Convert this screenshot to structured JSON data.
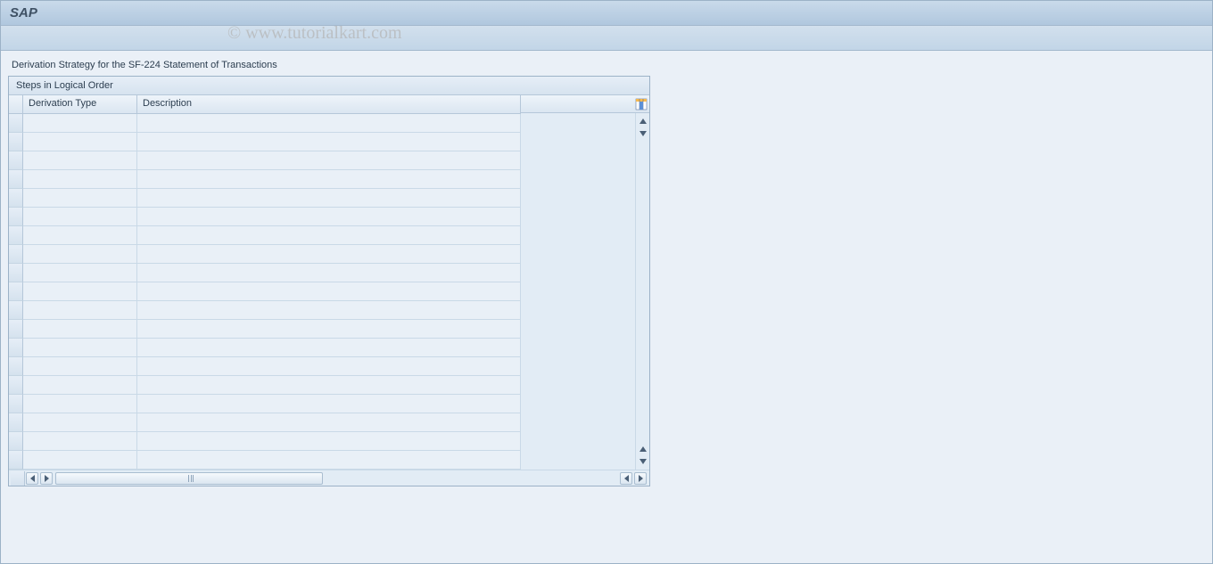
{
  "app": {
    "title": "SAP"
  },
  "page": {
    "subtitle": "Derivation Strategy for the SF-224 Statement of Transactions"
  },
  "table": {
    "title": "Steps in Logical Order",
    "columns": {
      "derivation_type": "Derivation Type",
      "description": "Description"
    },
    "rows": [
      {
        "derivation_type": "",
        "description": ""
      },
      {
        "derivation_type": "",
        "description": ""
      },
      {
        "derivation_type": "",
        "description": ""
      },
      {
        "derivation_type": "",
        "description": ""
      },
      {
        "derivation_type": "",
        "description": ""
      },
      {
        "derivation_type": "",
        "description": ""
      },
      {
        "derivation_type": "",
        "description": ""
      },
      {
        "derivation_type": "",
        "description": ""
      },
      {
        "derivation_type": "",
        "description": ""
      },
      {
        "derivation_type": "",
        "description": ""
      },
      {
        "derivation_type": "",
        "description": ""
      },
      {
        "derivation_type": "",
        "description": ""
      },
      {
        "derivation_type": "",
        "description": ""
      },
      {
        "derivation_type": "",
        "description": ""
      },
      {
        "derivation_type": "",
        "description": ""
      },
      {
        "derivation_type": "",
        "description": ""
      },
      {
        "derivation_type": "",
        "description": ""
      },
      {
        "derivation_type": "",
        "description": ""
      },
      {
        "derivation_type": "",
        "description": ""
      }
    ]
  },
  "watermark": "© www.tutorialkart.com"
}
